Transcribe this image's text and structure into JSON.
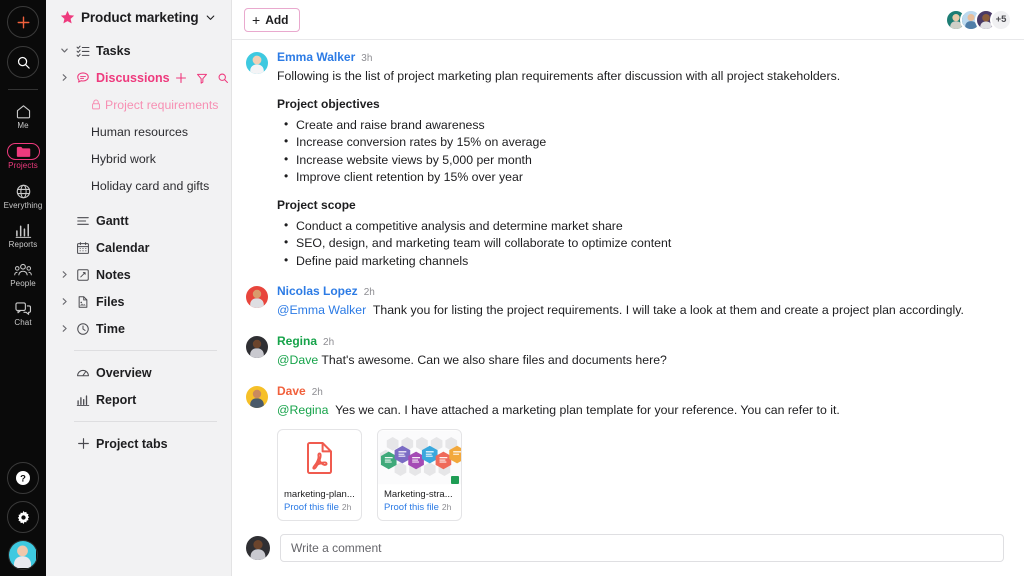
{
  "rail": {
    "add_icon": "plus-icon",
    "search_icon": "search-icon",
    "items": [
      {
        "label": "Me",
        "icon": "home-icon",
        "active": false
      },
      {
        "label": "Projects",
        "icon": "folder-icon",
        "active": true
      },
      {
        "label": "Everything",
        "icon": "globe-icon",
        "active": false
      },
      {
        "label": "Reports",
        "icon": "bar-chart-icon",
        "active": false
      },
      {
        "label": "People",
        "icon": "people-icon",
        "active": false
      },
      {
        "label": "Chat",
        "icon": "chat-icon",
        "active": false
      }
    ],
    "help_icon": "question-mark-icon",
    "settings_icon": "gear-icon",
    "user_avatar": "user-avatar"
  },
  "sidebar": {
    "project_title": "Product marketing",
    "star_icon": "star-icon",
    "chevron_icon": "chevron-down-icon",
    "tasks": {
      "label": "Tasks",
      "icon": "checklist-icon"
    },
    "discussions": {
      "label": "Discussions",
      "icon": "chat-bubble-icon",
      "actions": [
        "plus-icon",
        "filter-icon",
        "search-icon"
      ]
    },
    "discussion_items": [
      {
        "label": "Project requirements",
        "locked": true
      },
      {
        "label": "Human resources",
        "locked": false
      },
      {
        "label": "Hybrid work",
        "locked": false
      },
      {
        "label": "Holiday card and gifts",
        "locked": false
      }
    ],
    "views": [
      {
        "label": "Gantt",
        "icon": "gantt-icon",
        "expandable": false
      },
      {
        "label": "Calendar",
        "icon": "calendar-icon",
        "expandable": false
      },
      {
        "label": "Notes",
        "icon": "note-icon",
        "expandable": true
      },
      {
        "label": "Files",
        "icon": "file-icon",
        "expandable": true
      },
      {
        "label": "Time",
        "icon": "clock-icon",
        "expandable": true
      }
    ],
    "reports": [
      {
        "label": "Overview",
        "icon": "gauge-icon"
      },
      {
        "label": "Report",
        "icon": "bar-chart-icon"
      }
    ],
    "project_tabs": {
      "label": "Project tabs",
      "icon": "plus-icon"
    }
  },
  "topbar": {
    "add_label": "Add",
    "add_icon": "plus-icon",
    "avatars_overflow": "+5",
    "avatar_count": 3
  },
  "thread": {
    "posts": [
      {
        "author": "Emma Walker",
        "author_color": "#2c7be5",
        "time": "3h",
        "text": "Following is the list of project marketing plan requirements after discussion with all project stakeholders.",
        "sections": [
          {
            "title": "Project objectives",
            "items": [
              "Create and raise brand awareness",
              "Increase conversion rates by 15% on average",
              "Increase website views by 5,000 per month",
              "Improve client retention by 15% over year"
            ]
          },
          {
            "title": "Project scope",
            "items": [
              "Conduct a competitive analysis and determine market share",
              "SEO, design, and marketing team will collaborate to optimize content",
              "Define paid marketing channels"
            ]
          }
        ]
      },
      {
        "author": "Nicolas Lopez",
        "author_color": "#2c7be5",
        "time": "2h",
        "mention": "@Emma Walker",
        "mention_color": "#2c7be5",
        "text": "Thank you for listing the project requirements. I will take a look at them and create a project plan accordingly."
      },
      {
        "author": "Regina",
        "author_color": "#16a34a",
        "time": "2h",
        "mention": "@Dave",
        "mention_color": "#16a34a",
        "text": "That's awesome. Can we also share files and documents here?"
      },
      {
        "author": "Dave",
        "author_color": "#f1603c",
        "time": "2h",
        "mention": "@Regina",
        "mention_color": "#16a34a",
        "text": "Yes we can. I have attached a marketing plan template for your reference. You can refer to it."
      }
    ],
    "attachments": [
      {
        "name": "marketing-plan...",
        "proof_label": "Proof this file",
        "time": "2h",
        "kind": "pdf"
      },
      {
        "name": "Marketing-stra...",
        "proof_label": "Proof this file",
        "time": "2h",
        "kind": "spreadsheet"
      }
    ]
  },
  "composer": {
    "placeholder": "Write a comment",
    "avatar": "current-user-avatar"
  },
  "colors": {
    "accent": "#ee3a7d",
    "accent_light": "#f78fb3",
    "link": "#2c7be5",
    "rail_bg": "#0a0a0a",
    "sidebar_bg": "#f2f2f3"
  }
}
